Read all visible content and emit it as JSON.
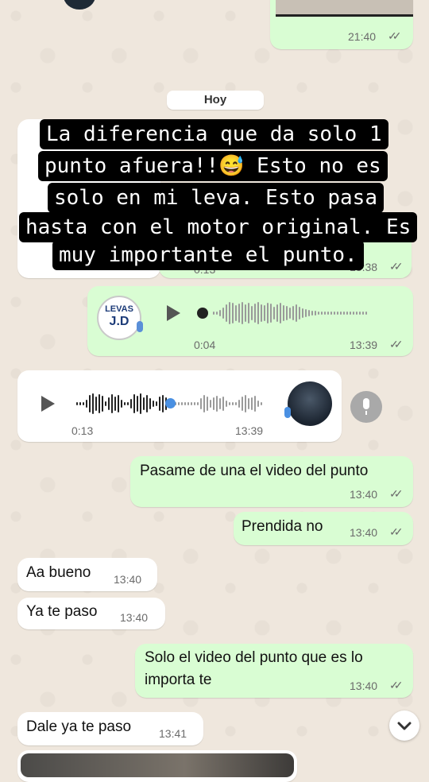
{
  "top_message": {
    "time": "21:40"
  },
  "day_separator": "Hoy",
  "caption_lines": [
    "La diferencia que da solo 1",
    "punto afuera!!😅 Esto no es",
    "solo en mi leva. Esto pasa",
    "hasta con el motor original. Es",
    "muy importante el punto."
  ],
  "hidden_voice": {
    "duration_partial": "0:13",
    "time_partial": "13:38"
  },
  "voice_out": {
    "logo_line1": "LEVAS",
    "logo_line2": "J.D",
    "duration": "0:04",
    "time": "13:39"
  },
  "voice_in": {
    "duration": "0:13",
    "time": "13:39"
  },
  "messages": [
    {
      "dir": "out",
      "text": "Pasame de una el video del punto",
      "time": "13:40"
    },
    {
      "dir": "out",
      "text": "Prendida no",
      "time": "13:40"
    },
    {
      "dir": "in",
      "text": "Aa bueno",
      "time": "13:40"
    },
    {
      "dir": "in",
      "text": "Ya te paso",
      "time": "13:40"
    },
    {
      "dir": "out",
      "text": "Solo el video del punto que es lo importa te",
      "time": "13:40"
    },
    {
      "dir": "in",
      "text": "Dale ya te paso",
      "time": "13:41"
    }
  ],
  "icons": {
    "read": "double-check-icon",
    "play": "play-icon",
    "mic": "microphone-icon",
    "scroll": "chevron-down-icon"
  },
  "colors": {
    "outgoing": "#d9fdd3",
    "incoming": "#ffffff",
    "wallpaper": "#efe7dd",
    "read_ticks": "#6b6b6b"
  }
}
